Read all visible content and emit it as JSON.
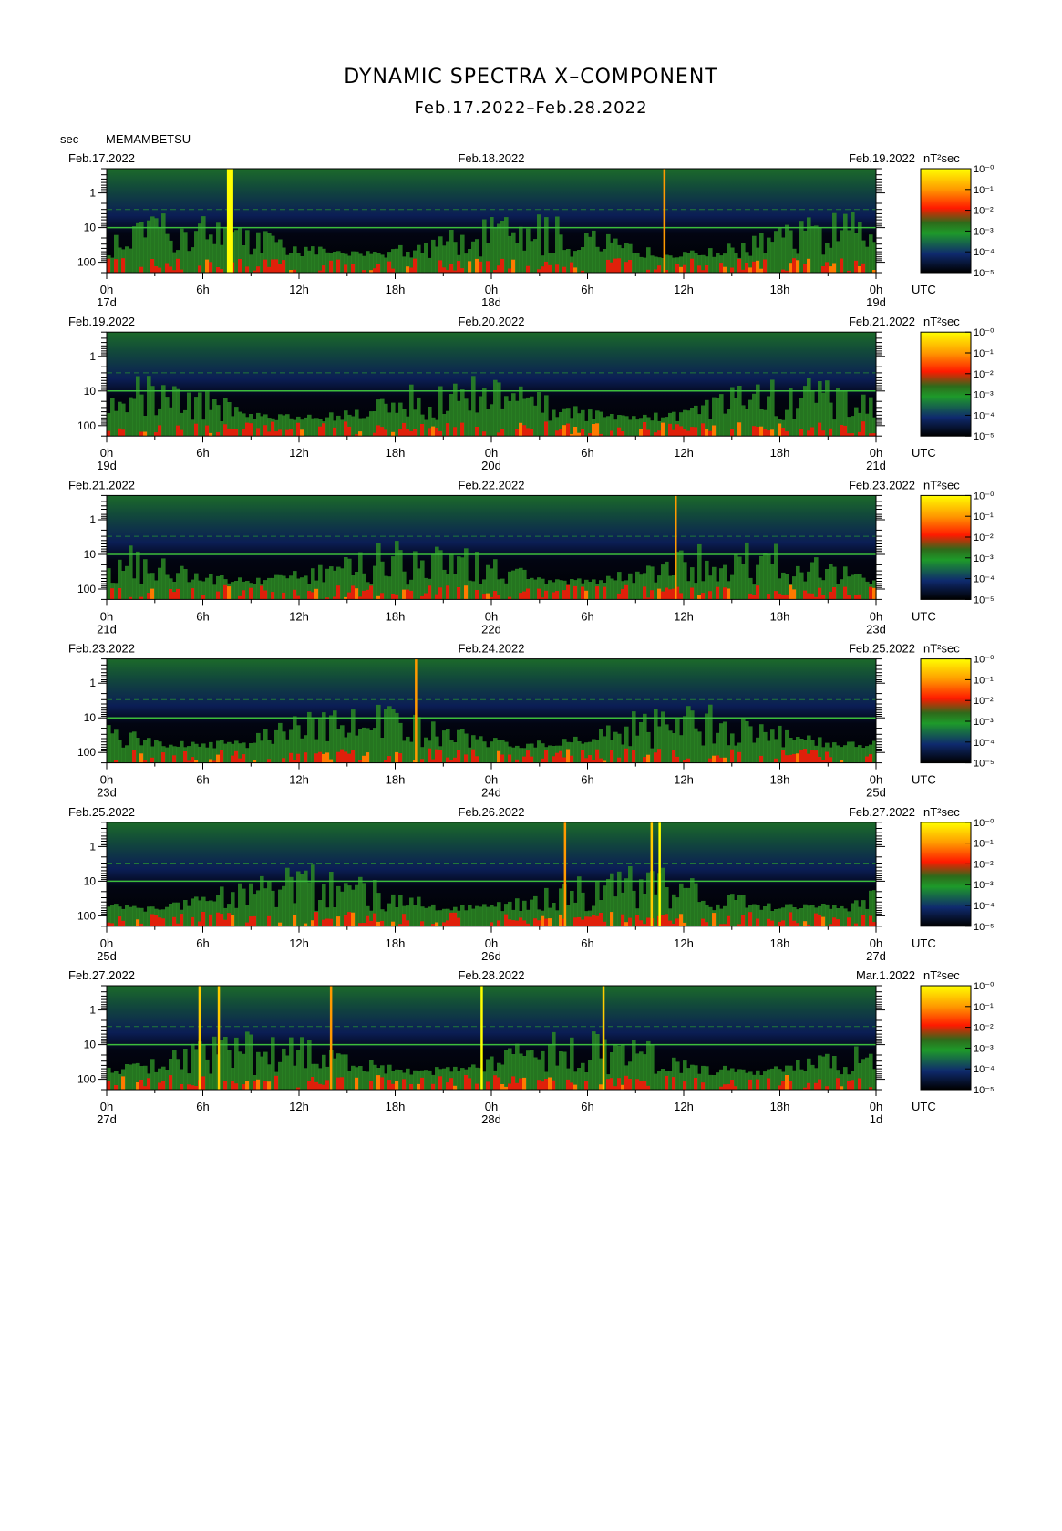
{
  "header": {
    "title": "DYNAMIC SPECTRA X–COMPONENT",
    "date_range": "Feb.17.2022–Feb.28.2022",
    "sec_label": "sec",
    "station": "MEMAMBETSU"
  },
  "chart_data": {
    "type": "heatmap",
    "x_ticks": [
      "0h",
      "6h",
      "12h",
      "18h",
      "0h",
      "6h",
      "12h",
      "18h",
      "0h"
    ],
    "y_ticks": [
      "1",
      "10",
      "100"
    ],
    "y_scale": "log",
    "y_range_sec": [
      0.2,
      200
    ],
    "utc_label": "UTC",
    "colorbar_unit": "nT²sec",
    "colorbar_ticks": [
      "10⁻⁰",
      "10⁻¹",
      "10⁻²",
      "10⁻³",
      "10⁻⁴",
      "10⁻⁵"
    ],
    "colorscale": [
      "#ffff00",
      "#ff9900",
      "#ff2200",
      "#1e9a2a",
      "#0f2a6e",
      "#000000"
    ],
    "panels": [
      {
        "left_date": "Feb.17.2022",
        "mid_date": "Feb.18.2022",
        "right_date": "Feb.19.2022",
        "day_labels": [
          "17d",
          "18d",
          "19d"
        ],
        "spikes": [
          {
            "t": 7.7,
            "color": "#ffff00",
            "wide": true
          },
          {
            "t": 34.8,
            "color": "#ff9900",
            "wide": false
          }
        ]
      },
      {
        "left_date": "Feb.19.2022",
        "mid_date": "Feb.20.2022",
        "right_date": "Feb.21.2022",
        "day_labels": [
          "19d",
          "20d",
          "21d"
        ],
        "spikes": []
      },
      {
        "left_date": "Feb.21.2022",
        "mid_date": "Feb.22.2022",
        "right_date": "Feb.23.2022",
        "day_labels": [
          "21d",
          "22d",
          "23d"
        ],
        "spikes": [
          {
            "t": 35.5,
            "color": "#ff9900",
            "wide": false
          }
        ]
      },
      {
        "left_date": "Feb.23.2022",
        "mid_date": "Feb.24.2022",
        "right_date": "Feb.25.2022",
        "day_labels": [
          "23d",
          "24d",
          "25d"
        ],
        "spikes": [
          {
            "t": 19.3,
            "color": "#ff9900",
            "wide": false
          }
        ]
      },
      {
        "left_date": "Feb.25.2022",
        "mid_date": "Feb.26.2022",
        "right_date": "Feb.27.2022",
        "day_labels": [
          "25d",
          "26d",
          "27d"
        ],
        "spikes": [
          {
            "t": 28.6,
            "color": "#ff9900",
            "wide": false
          },
          {
            "t": 34.0,
            "color": "#ffcc00",
            "wide": false
          },
          {
            "t": 34.5,
            "color": "#ffff00",
            "wide": false
          }
        ]
      },
      {
        "left_date": "Feb.27.2022",
        "mid_date": "Feb.28.2022",
        "right_date": "Mar.1.2022",
        "day_labels": [
          "27d",
          "28d",
          "1d"
        ],
        "spikes": [
          {
            "t": 5.8,
            "color": "#ffcc00",
            "wide": false
          },
          {
            "t": 7.0,
            "color": "#ffcc00",
            "wide": false
          },
          {
            "t": 14.0,
            "color": "#ff9900",
            "wide": false
          },
          {
            "t": 23.4,
            "color": "#ffff00",
            "wide": false
          },
          {
            "t": 31.0,
            "color": "#ffcc00",
            "wide": false
          }
        ]
      }
    ]
  }
}
